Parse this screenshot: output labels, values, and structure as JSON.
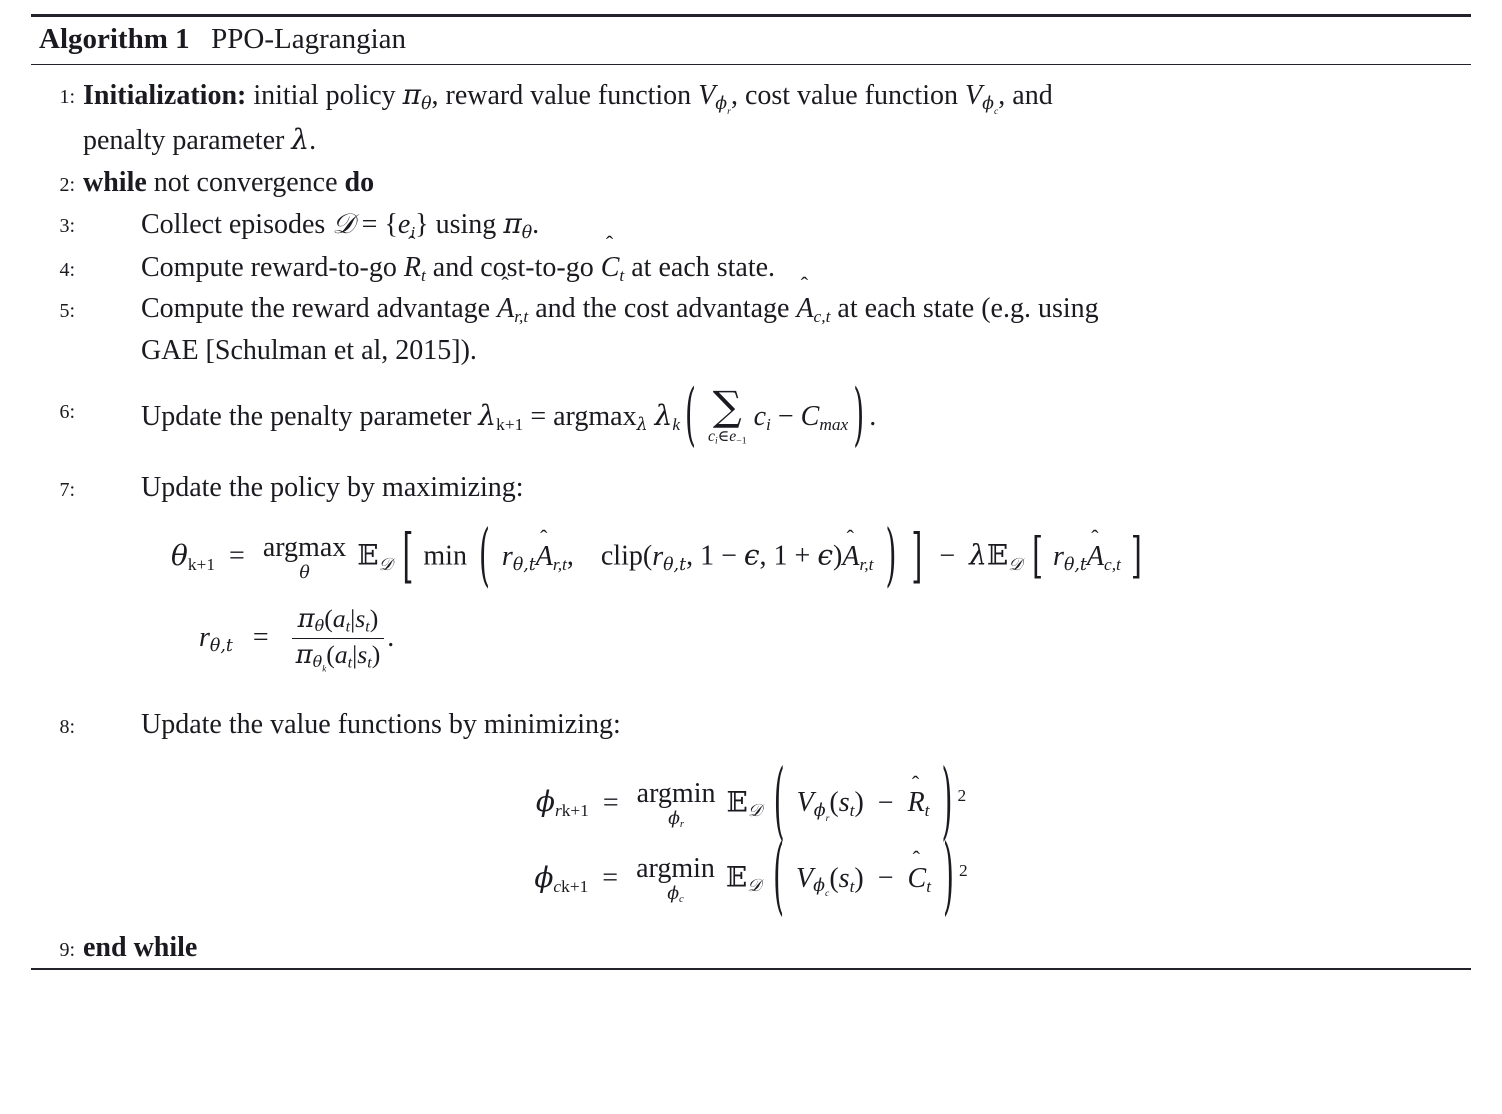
{
  "algorithm": {
    "label": "Algorithm 1",
    "name": "PPO-Lagrangian",
    "steps": [
      {
        "num": "1:",
        "keyword": "Initialization:",
        "text_a": "initial policy",
        "text_b": ", reward value function",
        "text_c": ", cost value function",
        "text_d": ", and",
        "text_e": "penalty parameter",
        "text_f": "."
      },
      {
        "num": "2:",
        "kw1": "while",
        "text": "not convergence",
        "kw2": "do"
      },
      {
        "num": "3:",
        "text_a": "Collect episodes",
        "text_b": "using",
        "text_c": "."
      },
      {
        "num": "4:",
        "text_a": "Compute reward-to-go",
        "text_b": "and cost-to-go",
        "text_c": "at each state."
      },
      {
        "num": "5:",
        "text_a": "Compute the reward advantage",
        "text_b": "and the cost advantage",
        "text_c": "at each state (e.g. using",
        "text_d": "GAE [Schulman et al, 2015])."
      },
      {
        "num": "6:",
        "text_a": "Update the penalty parameter",
        "text_b": "."
      },
      {
        "num": "7:",
        "text_a": "Update the policy by maximizing:"
      },
      {
        "num": "8:",
        "text_a": "Update the value functions by minimizing:"
      },
      {
        "num": "9:",
        "kw1": "end while"
      }
    ]
  },
  "math": {
    "pi": "π",
    "theta": "θ",
    "lambda": "λ",
    "phi": "ϕ",
    "epsilon": "ϵ",
    "V": "V",
    "D_cal": "𝒟",
    "E_bb": "𝔼",
    "sum": "∑",
    "in": "∈",
    "eq": "=",
    "minus": "−",
    "plus": "+",
    "hat": "ˆ",
    "argmax": "argmax",
    "argmin": "argmin",
    "min": "min",
    "clip": "clip",
    "C_max_sub": "max",
    "brace_open": "{",
    "brace_close": "}",
    "paren_open": "(",
    "paren_close": ")",
    "bracket_open": "[",
    "bracket_close": "]",
    "vert": "|",
    "one": "1",
    "two": "2",
    "k_plus_1": "k+1",
    "e_minus_1_sub": "−1",
    "subs": {
      "phi_r": "r",
      "phi_c": "c",
      "t": "t",
      "i": "i",
      "k": "k",
      "r_t": "r,t",
      "c_t": "c,t",
      "theta_t": "θ,t"
    },
    "symbols": {
      "A": "A",
      "R": "R",
      "C": "C",
      "c": "c",
      "e": "e",
      "r": "r",
      "a": "a",
      "s": "s"
    }
  },
  "colors": {
    "text": "#1a1a20",
    "rule": "#23232b",
    "background": "#ffffff"
  }
}
